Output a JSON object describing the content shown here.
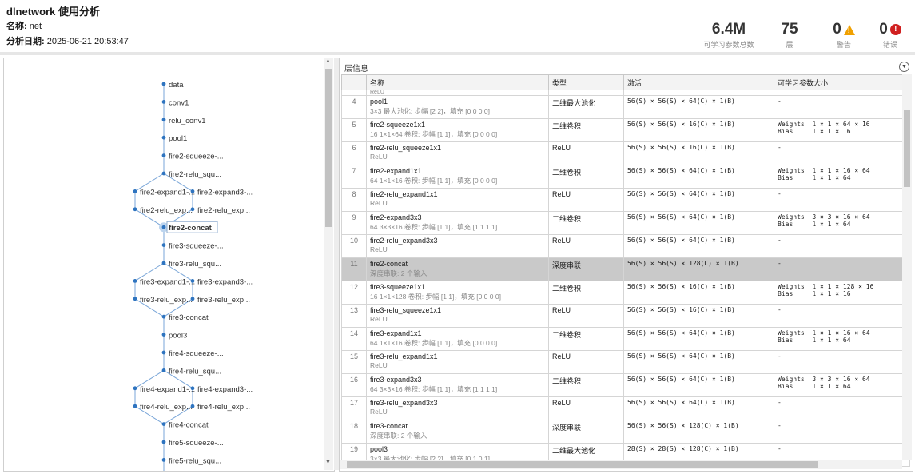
{
  "header": {
    "title": "dlnetwork 使用分析",
    "name_label": "名称:",
    "name_value": "net",
    "date_label": "分析日期:",
    "date_value": "2025-06-21 20:53:47",
    "stats": [
      {
        "value": "6.4M",
        "label": "可学习参数总数"
      },
      {
        "value": "75",
        "label": "层"
      },
      {
        "value": "0",
        "label": "警告",
        "icon": "warning-icon"
      },
      {
        "value": "0",
        "label": "错误",
        "icon": "error-icon"
      }
    ]
  },
  "graph": {
    "selected": "fire2-concat",
    "nodes": [
      "data",
      "conv1",
      "relu_conv1",
      "pool1",
      "fire2-squeeze-...",
      "fire2-relu_squ...",
      "fire2-expand1-...",
      "fire2-expand3-...",
      "fire2-relu_exp...",
      "fire2-relu_exp...",
      "fire2-concat",
      "fire3-squeeze-...",
      "fire3-relu_squ...",
      "fire3-expand1-...",
      "fire3-expand3-...",
      "fire3-relu_exp...",
      "fire3-relu_exp...",
      "fire3-concat",
      "pool3",
      "fire4-squeeze-...",
      "fire4-relu_squ...",
      "fire4-expand1-...",
      "fire4-expand3-...",
      "fire4-relu_exp...",
      "fire4-relu_exp...",
      "fire4-concat",
      "fire5-squeeze-...",
      "fire5-relu_squ..."
    ]
  },
  "table": {
    "panel_title": "层信息",
    "columns": [
      "",
      "名称",
      "类型",
      "激活",
      "可学习参数大小"
    ],
    "partial_top": "ReLU",
    "rows": [
      {
        "num": "4",
        "name": "pool1",
        "desc": "3×3 最大池化: 步幅 [2 2]，填充 [0 0 0 0]",
        "type": "二维最大池化",
        "act": "56(S) × 56(S) × 64(C) × 1(B)",
        "p1": "-",
        "p2": ""
      },
      {
        "num": "5",
        "name": "fire2-squeeze1x1",
        "desc": "16 1×1×64 卷积: 步幅 [1 1]，填充 [0 0 0 0]",
        "type": "二维卷积",
        "act": "56(S) × 56(S) × 16(C) × 1(B)",
        "p1": "Weights  1 × 1 × 64 × 16",
        "p2": "Bias     1 × 1 × 16"
      },
      {
        "num": "6",
        "name": "fire2-relu_squeeze1x1",
        "desc": "ReLU",
        "type": "ReLU",
        "act": "56(S) × 56(S) × 16(C) × 1(B)",
        "p1": "-",
        "p2": ""
      },
      {
        "num": "7",
        "name": "fire2-expand1x1",
        "desc": "64 1×1×16 卷积: 步幅 [1 1]，填充 [0 0 0 0]",
        "type": "二维卷积",
        "act": "56(S) × 56(S) × 64(C) × 1(B)",
        "p1": "Weights  1 × 1 × 16 × 64",
        "p2": "Bias     1 × 1 × 64"
      },
      {
        "num": "8",
        "name": "fire2-relu_expand1x1",
        "desc": "ReLU",
        "type": "ReLU",
        "act": "56(S) × 56(S) × 64(C) × 1(B)",
        "p1": "-",
        "p2": ""
      },
      {
        "num": "9",
        "name": "fire2-expand3x3",
        "desc": "64 3×3×16 卷积: 步幅 [1 1]，填充 [1 1 1 1]",
        "type": "二维卷积",
        "act": "56(S) × 56(S) × 64(C) × 1(B)",
        "p1": "Weights  3 × 3 × 16 × 64",
        "p2": "Bias     1 × 1 × 64"
      },
      {
        "num": "10",
        "name": "fire2-relu_expand3x3",
        "desc": "ReLU",
        "type": "ReLU",
        "act": "56(S) × 56(S) × 64(C) × 1(B)",
        "p1": "-",
        "p2": ""
      },
      {
        "num": "11",
        "name": "fire2-concat",
        "desc": "深度串联: 2 个输入",
        "type": "深度串联",
        "act": "56(S) × 56(S) × 128(C) × 1(B)",
        "p1": "-",
        "p2": "",
        "selected": true
      },
      {
        "num": "12",
        "name": "fire3-squeeze1x1",
        "desc": "16 1×1×128 卷积: 步幅 [1 1]，填充 [0 0 0 0]",
        "type": "二维卷积",
        "act": "56(S) × 56(S) × 16(C) × 1(B)",
        "p1": "Weights  1 × 1 × 128 × 16",
        "p2": "Bias     1 × 1 × 16"
      },
      {
        "num": "13",
        "name": "fire3-relu_squeeze1x1",
        "desc": "ReLU",
        "type": "ReLU",
        "act": "56(S) × 56(S) × 16(C) × 1(B)",
        "p1": "-",
        "p2": ""
      },
      {
        "num": "14",
        "name": "fire3-expand1x1",
        "desc": "64 1×1×16 卷积: 步幅 [1 1]，填充 [0 0 0 0]",
        "type": "二维卷积",
        "act": "56(S) × 56(S) × 64(C) × 1(B)",
        "p1": "Weights  1 × 1 × 16 × 64",
        "p2": "Bias     1 × 1 × 64"
      },
      {
        "num": "15",
        "name": "fire3-relu_expand1x1",
        "desc": "ReLU",
        "type": "ReLU",
        "act": "56(S) × 56(S) × 64(C) × 1(B)",
        "p1": "-",
        "p2": ""
      },
      {
        "num": "16",
        "name": "fire3-expand3x3",
        "desc": "64 3×3×16 卷积: 步幅 [1 1]，填充 [1 1 1 1]",
        "type": "二维卷积",
        "act": "56(S) × 56(S) × 64(C) × 1(B)",
        "p1": "Weights  3 × 3 × 16 × 64",
        "p2": "Bias     1 × 1 × 64"
      },
      {
        "num": "17",
        "name": "fire3-relu_expand3x3",
        "desc": "ReLU",
        "type": "ReLU",
        "act": "56(S) × 56(S) × 64(C) × 1(B)",
        "p1": "-",
        "p2": ""
      },
      {
        "num": "18",
        "name": "fire3-concat",
        "desc": "深度串联: 2 个输入",
        "type": "深度串联",
        "act": "56(S) × 56(S) × 128(C) × 1(B)",
        "p1": "-",
        "p2": ""
      },
      {
        "num": "19",
        "name": "pool3",
        "desc": "3×3 最大池化: 步幅 [2 2]，填充 [0 1 0 1]",
        "type": "二维最大池化",
        "act": "28(S) × 28(S) × 128(C) × 1(B)",
        "p1": "-",
        "p2": ""
      }
    ]
  },
  "colors": {
    "accent": "#2e74c0",
    "selected_row": "#c9c9c9",
    "warning": "#f0a000",
    "error": "#d02020"
  }
}
